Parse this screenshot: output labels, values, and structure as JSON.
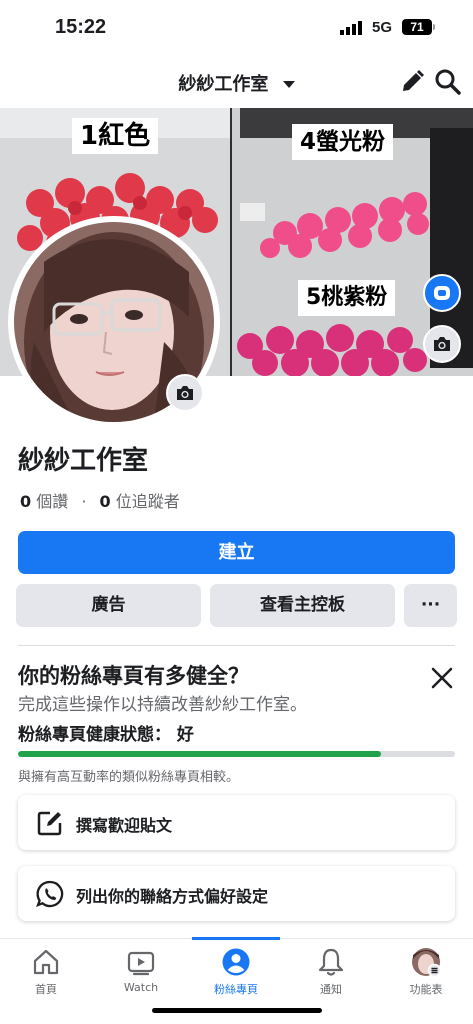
{
  "status_bar": {
    "time": "15:22",
    "network": "5G",
    "battery": "71"
  },
  "header": {
    "title": "紗紗工作室"
  },
  "cover": {
    "labels": [
      {
        "text": "1紅色"
      },
      {
        "text": "4螢光粉"
      },
      {
        "text": "5桃紫粉"
      }
    ]
  },
  "page": {
    "name": "紗紗工作室",
    "likes_count": "0",
    "likes_label": "個讚",
    "followers_count": "0",
    "followers_label": "位追蹤者"
  },
  "actions": {
    "create_label": "建立",
    "ads_label": "廣告",
    "dashboard_label": "查看主控板",
    "more_label": "···"
  },
  "health": {
    "title": "你的粉絲專頁有多健全？",
    "subtitle": "完成這些操作以持續改善紗紗工作室。",
    "status_label": "粉絲專頁健康狀態：",
    "status_value": "好",
    "progress": 0.83,
    "note": "與擁有高互動率的類似粉絲專頁相較。"
  },
  "tasks": [
    {
      "label": "撰寫歡迎貼文",
      "icon": "compose-icon"
    },
    {
      "label": "列出你的聯絡方式偏好設定",
      "icon": "whatsapp-icon"
    }
  ],
  "tabs": [
    {
      "label": "首頁",
      "icon": "home-icon"
    },
    {
      "label": "Watch",
      "icon": "video-icon"
    },
    {
      "label": "粉絲專頁",
      "icon": "page-profile-icon",
      "active": true
    },
    {
      "label": "通知",
      "icon": "bell-icon"
    },
    {
      "label": "功能表",
      "icon": "menu-avatar-icon"
    }
  ],
  "colors": {
    "primary": "#1877f2",
    "health_good": "#20a24a",
    "secondary_text": "#65676b",
    "button_gray": "#e4e6eb"
  }
}
